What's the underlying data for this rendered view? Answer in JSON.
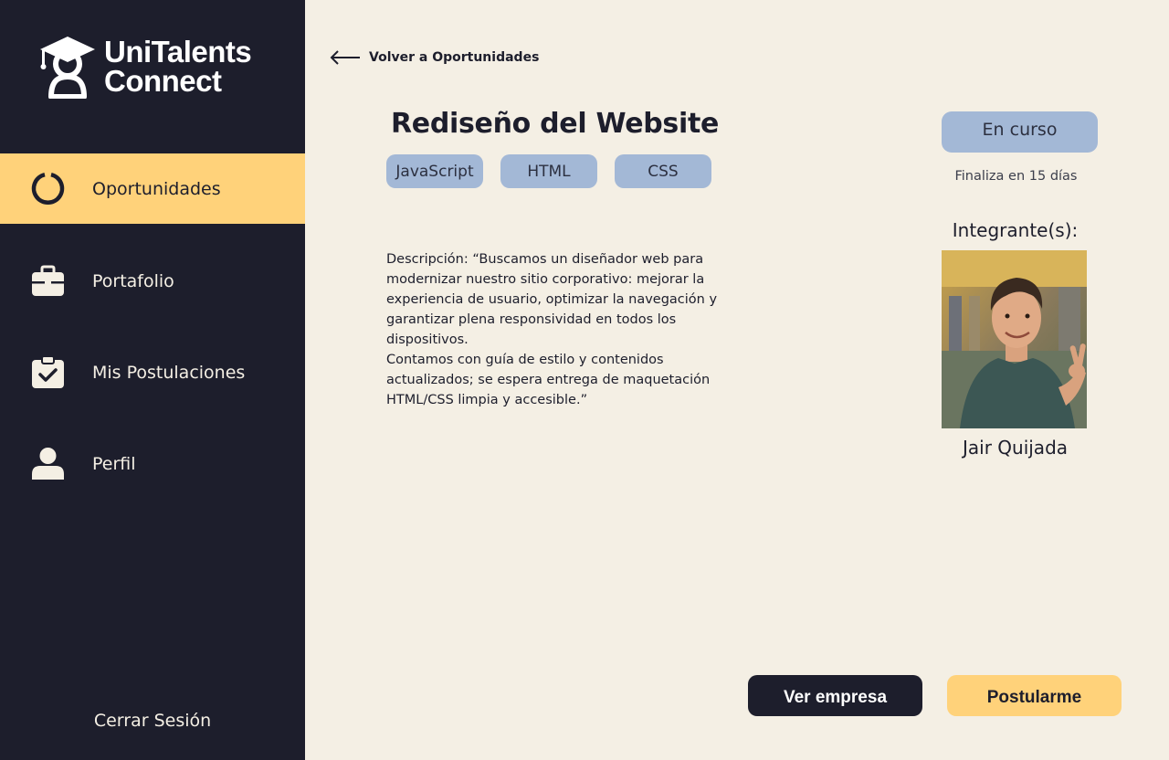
{
  "brand": {
    "line1": "UniTalents",
    "line2": "Connect",
    "logo_icon": "graduate-cap-person-icon"
  },
  "sidebar": {
    "items": [
      {
        "label": "Oportunidades",
        "icon": "circle-progress-icon",
        "active": true
      },
      {
        "label": "Portafolio",
        "icon": "briefcase-icon",
        "active": false
      },
      {
        "label": "Mis Postulaciones",
        "icon": "clipboard-check-icon",
        "active": false
      },
      {
        "label": "Perfil",
        "icon": "user-icon",
        "active": false
      }
    ],
    "logout_label": "Cerrar Sesión"
  },
  "main": {
    "back_label": "Volver a Oportunidades",
    "title": "Rediseño del Website",
    "tags": [
      "JavaScript",
      "HTML",
      "CSS"
    ],
    "description": [
      "Descripción: “Buscamos un diseñador web para modernizar nuestro sitio corporativo: mejorar la experiencia de usuario, optimizar la navegación y garantizar plena responsividad en todos los dispositivos.",
      "Contamos con guía de estilo y contenidos actualizados; se espera entrega de maquetación HTML/CSS limpia y accesible.”"
    ],
    "status": "En curso",
    "deadline": "Finaliza en 15 días",
    "members_heading": "Integrante(s):",
    "member": {
      "name": "Jair Quijada"
    },
    "buttons": {
      "company": "Ver empresa",
      "apply": "Postularme"
    }
  },
  "colors": {
    "sidebar_bg": "#1d1e2c",
    "page_bg": "#f4efe4",
    "accent_yellow": "#ffd27a",
    "tag_blue": "#a3b8d6"
  }
}
